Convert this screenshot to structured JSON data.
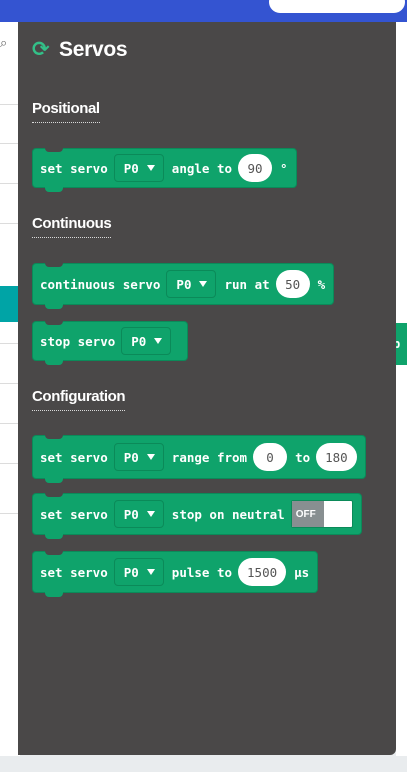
{
  "flyout": {
    "title": "Servos",
    "icon": "refresh-icon"
  },
  "sections": {
    "positional": "Positional",
    "continuous": "Continuous",
    "configuration": "Configuration"
  },
  "blocks": {
    "angle": {
      "prefix": "set servo",
      "pin": "P0",
      "mid": "angle to",
      "value": "90",
      "suffix": "°"
    },
    "continuous_run": {
      "prefix": "continuous servo",
      "pin": "P0",
      "mid": "run at",
      "value": "50",
      "suffix": "%"
    },
    "stop": {
      "prefix": "stop servo",
      "pin": "P0"
    },
    "range": {
      "prefix": "set servo",
      "pin": "P0",
      "mid": "range from",
      "from": "0",
      "to_label": "to",
      "to": "180"
    },
    "neutral": {
      "prefix": "set servo",
      "pin": "P0",
      "mid": "stop on neutral",
      "toggle": "OFF"
    },
    "pulse": {
      "prefix": "set servo",
      "pin": "P0",
      "mid": "pulse to",
      "value": "1500",
      "suffix": "μs"
    }
  },
  "peek_block_text": "p",
  "colors": {
    "topbar": "#3454d1",
    "flyout_bg": "#4a4848",
    "servo_block": "#0fa36b",
    "servo_icon": "#33c088"
  }
}
